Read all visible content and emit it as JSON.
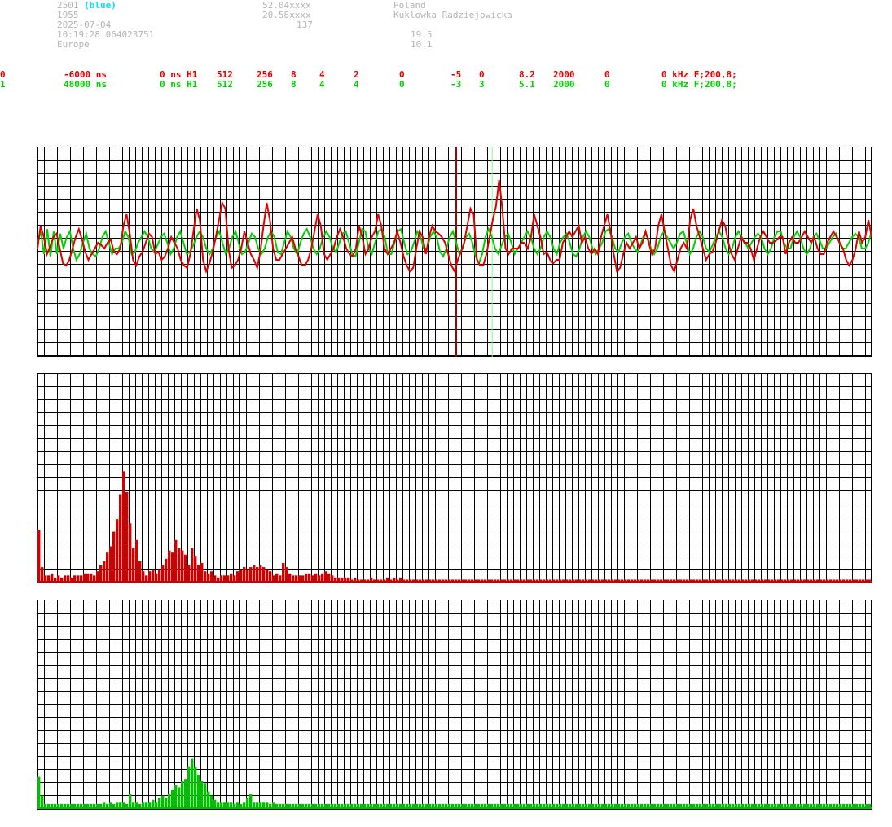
{
  "header": {
    "id": "2501",
    "id_color_note": "(blue)",
    "year": "1955",
    "date": "2025-07-04",
    "time": "10:19:28.064023751",
    "region": "Europe",
    "lat": "52.04xxxx",
    "lon": "20.58xxxx",
    "alt": "137",
    "country": "Poland",
    "place": "Kuklowka Radziejowicka",
    "val1": "19.5",
    "val2": "10.1"
  },
  "channels": [
    {
      "fields": [
        "0",
        "-6000 ns",
        "0 ns H1",
        "512",
        "256",
        "8",
        "4",
        "2",
        "0",
        "-5",
        "0",
        "8.2",
        "2000",
        "0",
        "0 kHz F;200,8;"
      ],
      "color": "#e00000"
    },
    {
      "fields": [
        "1",
        "48000 ns",
        "0 ns H1",
        "512",
        "256",
        "8",
        "4",
        "4",
        "0",
        "-3",
        "3",
        "5.1",
        "2000",
        "0",
        "0 kHz F;200,8;"
      ],
      "color": "#00d000"
    }
  ],
  "chart_data": [
    {
      "type": "line",
      "ylim": [
        -1,
        1
      ],
      "x_range": [
        0,
        255
      ],
      "cursors": [
        {
          "x": 128,
          "color": "#a00000"
        },
        {
          "x": 139,
          "color": "#80ff80"
        }
      ],
      "series": [
        {
          "color": "#e00000",
          "values": [
            -0.05,
            0.15,
            0.05,
            -0.1,
            -0.03,
            0.05,
            0.08,
            -0.05,
            -0.18,
            -0.2,
            -0.15,
            -0.05,
            0.05,
            0.12,
            0.03,
            -0.08,
            -0.15,
            -0.1,
            -0.05,
            0.0,
            -0.02,
            -0.05,
            0.0,
            0.03,
            -0.08,
            -0.1,
            -0.05,
            0.15,
            0.25,
            0.08,
            -0.15,
            -0.2,
            -0.12,
            -0.08,
            0.0,
            0.08,
            0.05,
            -0.1,
            -0.08,
            -0.15,
            -0.12,
            -0.05,
            0.05,
            0.0,
            -0.05,
            -0.15,
            -0.2,
            -0.22,
            -0.1,
            0.1,
            0.3,
            0.2,
            -0.15,
            -0.25,
            -0.18,
            -0.08,
            0.05,
            0.2,
            0.35,
            0.3,
            -0.05,
            -0.22,
            -0.2,
            -0.15,
            -0.05,
            0.1,
            0.0,
            -0.1,
            -0.15,
            -0.22,
            -0.08,
            0.15,
            0.35,
            0.2,
            -0.05,
            -0.15,
            -0.15,
            -0.1,
            -0.05,
            0.0,
            0.05,
            -0.05,
            -0.12,
            -0.2,
            -0.2,
            -0.15,
            -0.05,
            0.1,
            0.25,
            0.15,
            -0.1,
            -0.15,
            -0.1,
            -0.05,
            0.05,
            0.12,
            0.05,
            -0.05,
            -0.1,
            -0.12,
            -0.05,
            0.15,
            0.05,
            -0.1,
            -0.05,
            0.05,
            0.1,
            0.25,
            0.15,
            -0.05,
            -0.1,
            -0.05,
            0.0,
            0.1,
            0.0,
            -0.12,
            -0.2,
            -0.25,
            -0.22,
            -0.05,
            0.1,
            0.05,
            -0.1,
            0.05,
            0.15,
            0.1,
            0.08,
            0.05,
            0.0,
            -0.1,
            -0.2,
            -0.25,
            -0.15,
            -0.08,
            0.0,
            0.15,
            0.3,
            0.25,
            -0.15,
            -0.2,
            -0.2,
            -0.1,
            0.05,
            0.2,
            0.32,
            0.55,
            0.3,
            -0.05,
            -0.1,
            -0.05,
            -0.05,
            -0.05,
            0.0,
            0.0,
            -0.05,
            0.05,
            0.25,
            0.15,
            0.05,
            -0.1,
            -0.08,
            -0.15,
            -0.18,
            -0.15,
            -0.15,
            0.0,
            0.05,
            0.1,
            0.05,
            0.1,
            0.15,
            0.0,
            0.05,
            -0.05,
            -0.1,
            -0.05,
            -0.1,
            0.05,
            0.15,
            0.25,
            0.1,
            -0.1,
            -0.25,
            -0.22,
            -0.1,
            0.0,
            -0.05,
            0.0,
            0.05,
            -0.05,
            0.0,
            0.1,
            0.0,
            -0.1,
            -0.05,
            0.15,
            0.25,
            0.1,
            -0.05,
            -0.2,
            -0.25,
            -0.15,
            -0.05,
            0.0,
            -0.05,
            0.2,
            0.3,
            0.15,
            0.05,
            -0.05,
            -0.15,
            -0.1,
            -0.08,
            0.0,
            0.1,
            0.2,
            0.15,
            0.0,
            -0.1,
            -0.15,
            -0.05,
            0.05,
            0.0,
            0.0,
            -0.05,
            -0.15,
            -0.05,
            0.05,
            0.1,
            0.05,
            0.0,
            0.0,
            0.02,
            0.05,
            0.05,
            -0.1,
            0.0,
            0.05,
            0.0,
            0.0,
            0.05,
            0.1,
            0.05,
            0.0,
            0.05,
            -0.05,
            -0.1,
            -0.1,
            0.0,
            0.05,
            0.1,
            0.05,
            0.0,
            -0.05,
            -0.15,
            -0.2,
            -0.15,
            -0.05,
            0.1,
            0.0,
            0.05,
            0.2,
            0.05
          ]
        },
        {
          "color": "#00d000",
          "values": [
            0.0,
            0.1,
            -0.1,
            0.12,
            -0.12,
            0.1,
            -0.1,
            0.08,
            -0.05,
            0.05,
            0.1,
            -0.05,
            -0.15,
            -0.1,
            0.0,
            0.08,
            -0.05,
            -0.1,
            -0.12,
            -0.05,
            0.05,
            0.1,
            0.0,
            -0.1,
            -0.05,
            -0.05,
            0.0,
            0.1,
            0.05,
            -0.1,
            -0.08,
            0.0,
            0.05,
            0.1,
            0.05,
            -0.05,
            -0.08,
            -0.02,
            0.05,
            0.08,
            0.0,
            -0.1,
            -0.05,
            0.05,
            0.1,
            0.0,
            -0.1,
            -0.08,
            -0.02,
            0.05,
            0.1,
            0.05,
            -0.05,
            -0.1,
            -0.05,
            0.05,
            0.1,
            0.0,
            -0.1,
            -0.05,
            0.05,
            0.1,
            0.0,
            -0.1,
            -0.08,
            0.0,
            0.08,
            0.05,
            -0.05,
            -0.1,
            -0.05,
            0.05,
            0.1,
            0.05,
            -0.08,
            -0.1,
            0.0,
            0.1,
            0.05,
            -0.05,
            -0.1,
            0.0,
            0.08,
            0.12,
            0.05,
            -0.05,
            -0.1,
            -0.05,
            0.05,
            0.1,
            0.05,
            -0.05,
            -0.08,
            0.0,
            0.08,
            0.1,
            0.0,
            -0.1,
            -0.12,
            0.0,
            0.12,
            0.1,
            -0.05,
            -0.1,
            0.0,
            0.1,
            0.12,
            0.05,
            -0.1,
            -0.1,
            0.0,
            0.1,
            0.12,
            0.0,
            -0.1,
            -0.08,
            0.0,
            0.1,
            0.05,
            -0.05,
            -0.05,
            0.05,
            0.1,
            0.05,
            -0.08,
            -0.12,
            -0.05,
            0.05,
            0.1,
            0.0,
            -0.1,
            -0.05,
            0.05,
            0.08,
            0.0,
            -0.12,
            -0.18,
            -0.1,
            0.05,
            0.12,
            0.05,
            -0.05,
            -0.1,
            -0.02,
            0.05,
            0.08,
            0.0,
            -0.1,
            -0.05,
            0.0,
            0.05,
            0.1,
            0.05,
            -0.05,
            -0.1,
            -0.05,
            0.05,
            0.1,
            0.05,
            -0.05,
            -0.1,
            0.0,
            0.05,
            0.08,
            0.0,
            -0.1,
            -0.12,
            -0.05,
            0.05,
            0.1,
            0.05,
            -0.05,
            -0.1,
            -0.05,
            0.0,
            0.1,
            0.12,
            0.05,
            -0.05,
            -0.08,
            0.0,
            0.05,
            0.08,
            0.0,
            -0.05,
            -0.08,
            0.0,
            0.08,
            0.05,
            -0.05,
            -0.1,
            -0.05,
            0.05,
            0.1,
            0.05,
            0.0,
            -0.05,
            0.0,
            0.08,
            0.1,
            0.0,
            -0.1,
            -0.05,
            0.05,
            0.1,
            0.05,
            -0.05,
            -0.08,
            -0.02,
            0.05,
            0.1,
            0.05,
            -0.05,
            -0.1,
            -0.05,
            0.05,
            0.1,
            0.05,
            0.0,
            -0.05,
            0.0,
            0.05,
            0.08,
            0.05,
            -0.05,
            -0.1,
            -0.05,
            0.05,
            0.1,
            0.1,
            0.0,
            -0.05,
            -0.05,
            0.05,
            0.1,
            0.05,
            -0.05,
            -0.1,
            -0.05,
            0.05,
            0.08,
            0.02,
            -0.05,
            -0.05,
            0.0,
            0.05,
            0.08,
            0.0,
            -0.05,
            -0.05,
            0.0,
            0.05,
            0.08,
            0.05,
            -0.05,
            -0.05,
            0.0,
            0.1
          ]
        }
      ]
    },
    {
      "type": "bar",
      "color": "#d00000",
      "ylim": [
        0,
        1
      ],
      "values": [
        0.25,
        0.07,
        0.03,
        0.03,
        0.04,
        0.02,
        0.03,
        0.02,
        0.03,
        0.03,
        0.02,
        0.03,
        0.03,
        0.03,
        0.04,
        0.04,
        0.04,
        0.03,
        0.05,
        0.08,
        0.1,
        0.14,
        0.17,
        0.24,
        0.3,
        0.42,
        0.53,
        0.43,
        0.28,
        0.16,
        0.2,
        0.1,
        0.05,
        0.03,
        0.05,
        0.06,
        0.04,
        0.06,
        0.08,
        0.11,
        0.15,
        0.14,
        0.2,
        0.16,
        0.15,
        0.13,
        0.08,
        0.16,
        0.12,
        0.08,
        0.09,
        0.05,
        0.04,
        0.05,
        0.03,
        0.02,
        0.03,
        0.03,
        0.03,
        0.04,
        0.03,
        0.05,
        0.06,
        0.07,
        0.06,
        0.07,
        0.08,
        0.07,
        0.08,
        0.07,
        0.06,
        0.05,
        0.03,
        0.04,
        0.03,
        0.09,
        0.07,
        0.04,
        0.03,
        0.03,
        0.03,
        0.03,
        0.04,
        0.04,
        0.03,
        0.04,
        0.03,
        0.04,
        0.05,
        0.04,
        0.03,
        0.02,
        0.02,
        0.02,
        0.02,
        0.02,
        0.01,
        0.02,
        0.01,
        0.01,
        0.01,
        0.01,
        0.02,
        0.01,
        0.01,
        0.01,
        0.01,
        0.02,
        0.01,
        0.02,
        0.01,
        0.02,
        0.01,
        0.01,
        0.01,
        0.01,
        0.01,
        0.01,
        0.01,
        0.01,
        0.01,
        0.01,
        0.01,
        0.01,
        0.01,
        0.01,
        0.01,
        0.01,
        0.01,
        0.01,
        0.01,
        0.01,
        0.01,
        0.01,
        0.01,
        0.01,
        0.01,
        0.01,
        0.01,
        0.01,
        0.01,
        0.01,
        0.01,
        0.01,
        0.01,
        0.01,
        0.01,
        0.01,
        0.01,
        0.01,
        0.01,
        0.01,
        0.01,
        0.01,
        0.01,
        0.01,
        0.01,
        0.01,
        0.01,
        0.01,
        0.01,
        0.01,
        0.01,
        0.01,
        0.01,
        0.01,
        0.01,
        0.01,
        0.01,
        0.01,
        0.01,
        0.01,
        0.01,
        0.01,
        0.01,
        0.01,
        0.01,
        0.01,
        0.01,
        0.01,
        0.01,
        0.01,
        0.01,
        0.01,
        0.01,
        0.01,
        0.01,
        0.01,
        0.01,
        0.01,
        0.01,
        0.01,
        0.01,
        0.01,
        0.01,
        0.01,
        0.01,
        0.01,
        0.01,
        0.01,
        0.01,
        0.01,
        0.01,
        0.01,
        0.01,
        0.01,
        0.01,
        0.01,
        0.01,
        0.01,
        0.01,
        0.01,
        0.01,
        0.01,
        0.01,
        0.01,
        0.01,
        0.01,
        0.01,
        0.01,
        0.01,
        0.01,
        0.01,
        0.01,
        0.01,
        0.01,
        0.01,
        0.01,
        0.01,
        0.01,
        0.01,
        0.01,
        0.01,
        0.01,
        0.01,
        0.01,
        0.01,
        0.01,
        0.01,
        0.01,
        0.01,
        0.01,
        0.01,
        0.01,
        0.01,
        0.01,
        0.01,
        0.01,
        0.01,
        0.01,
        0.01,
        0.01,
        0.01,
        0.01,
        0.01,
        0.01
      ]
    },
    {
      "type": "bar",
      "color": "#00c000",
      "ylim": [
        0,
        1
      ],
      "values": [
        0.15,
        0.06,
        0.02,
        0.02,
        0.02,
        0.02,
        0.02,
        0.02,
        0.02,
        0.02,
        0.02,
        0.02,
        0.02,
        0.02,
        0.02,
        0.02,
        0.02,
        0.02,
        0.02,
        0.02,
        0.03,
        0.02,
        0.03,
        0.02,
        0.03,
        0.03,
        0.03,
        0.02,
        0.07,
        0.03,
        0.03,
        0.02,
        0.03,
        0.03,
        0.03,
        0.04,
        0.03,
        0.05,
        0.06,
        0.05,
        0.07,
        0.09,
        0.11,
        0.1,
        0.13,
        0.14,
        0.2,
        0.24,
        0.2,
        0.16,
        0.13,
        0.12,
        0.08,
        0.06,
        0.04,
        0.03,
        0.03,
        0.03,
        0.03,
        0.03,
        0.02,
        0.03,
        0.02,
        0.03,
        0.05,
        0.07,
        0.03,
        0.03,
        0.03,
        0.03,
        0.03,
        0.02,
        0.03,
        0.02,
        0.02,
        0.02,
        0.02,
        0.02,
        0.02,
        0.02,
        0.02,
        0.02,
        0.02,
        0.02,
        0.02,
        0.02,
        0.02,
        0.02,
        0.02,
        0.02,
        0.02,
        0.02,
        0.02,
        0.02,
        0.02,
        0.02,
        0.02,
        0.02,
        0.02,
        0.02,
        0.02,
        0.02,
        0.02,
        0.02,
        0.02,
        0.02,
        0.02,
        0.02,
        0.02,
        0.02,
        0.02,
        0.02,
        0.02,
        0.02,
        0.02,
        0.02,
        0.02,
        0.02,
        0.02,
        0.02,
        0.02,
        0.02,
        0.02,
        0.02,
        0.02,
        0.02,
        0.02,
        0.02,
        0.02,
        0.02,
        0.02,
        0.02,
        0.02,
        0.02,
        0.02,
        0.02,
        0.02,
        0.02,
        0.02,
        0.02,
        0.02,
        0.02,
        0.02,
        0.02,
        0.02,
        0.02,
        0.02,
        0.02,
        0.02,
        0.02,
        0.02,
        0.02,
        0.02,
        0.02,
        0.02,
        0.02,
        0.02,
        0.02,
        0.02,
        0.02,
        0.02,
        0.02,
        0.02,
        0.02,
        0.02,
        0.02,
        0.02,
        0.02,
        0.02,
        0.02,
        0.02,
        0.02,
        0.02,
        0.02,
        0.02,
        0.02,
        0.02,
        0.02,
        0.02,
        0.02,
        0.02,
        0.02,
        0.02,
        0.02,
        0.02,
        0.02,
        0.02,
        0.02,
        0.02,
        0.02,
        0.02,
        0.02,
        0.02,
        0.02,
        0.02,
        0.02,
        0.02,
        0.02,
        0.02,
        0.02,
        0.02,
        0.02,
        0.02,
        0.02,
        0.02,
        0.02,
        0.02,
        0.02,
        0.02,
        0.02,
        0.02,
        0.02,
        0.02,
        0.02,
        0.02,
        0.02,
        0.02,
        0.02,
        0.02,
        0.02,
        0.02,
        0.02,
        0.02,
        0.02,
        0.02,
        0.02,
        0.02,
        0.02,
        0.02,
        0.02,
        0.02,
        0.02,
        0.02,
        0.02,
        0.02,
        0.02,
        0.02,
        0.02,
        0.02,
        0.02,
        0.02,
        0.02,
        0.02,
        0.02,
        0.02,
        0.02,
        0.02,
        0.02,
        0.02,
        0.02,
        0.02,
        0.02,
        0.02,
        0.02,
        0.02,
        0.02
      ]
    }
  ]
}
